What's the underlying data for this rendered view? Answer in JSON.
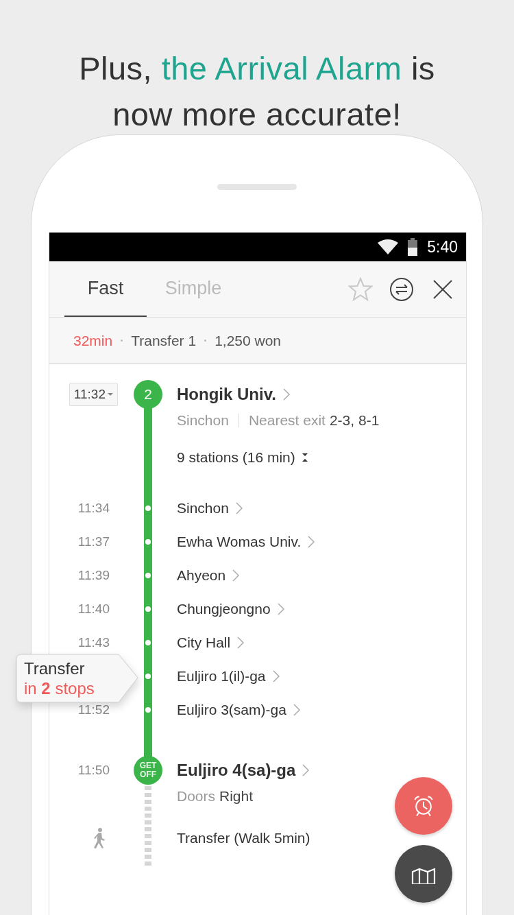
{
  "headline": {
    "lines": [
      [
        {
          "text": "Plus, ",
          "highlight": false
        },
        {
          "text": "the Arrival Alarm",
          "highlight": true
        },
        {
          "text": " is",
          "highlight": false
        }
      ],
      [
        {
          "text": "now more accurate!",
          "highlight": false
        }
      ]
    ]
  },
  "status_bar": {
    "time": "5:40"
  },
  "tabs": [
    {
      "label": "Fast",
      "selected": true
    },
    {
      "label": "Simple",
      "selected": false
    }
  ],
  "summary": {
    "duration": "32min",
    "transfers": "Transfer 1",
    "fare": "1,250 won"
  },
  "start": {
    "time": "11:32",
    "line": "2",
    "station": "Hongik Univ.",
    "direction": "Sinchon",
    "exit_label": "Nearest exit",
    "exit": "2-3, 8-1",
    "stations_summary": "9 stations (16 min)"
  },
  "stops": [
    {
      "time": "11:34",
      "name": "Sinchon"
    },
    {
      "time": "11:37",
      "name": "Ewha Womas Univ."
    },
    {
      "time": "11:39",
      "name": "Ahyeon"
    },
    {
      "time": "11:40",
      "name": "Chungjeongno"
    },
    {
      "time": "11:43",
      "name": "City Hall"
    },
    {
      "name": "Euljiro 1(il)-ga"
    },
    {
      "time": "11:52",
      "name": "Euljiro 3(sam)-ga"
    }
  ],
  "callout": {
    "title": "Transfer",
    "text": "in **2** stops"
  },
  "end": {
    "time": "11:50",
    "badge": [
      "GET",
      "OFF"
    ],
    "station": "Euljiro 4(sa)-ga",
    "doors_label": "Doors",
    "doors": "Right"
  },
  "walk": {
    "text": "Transfer (Walk 5min)"
  }
}
